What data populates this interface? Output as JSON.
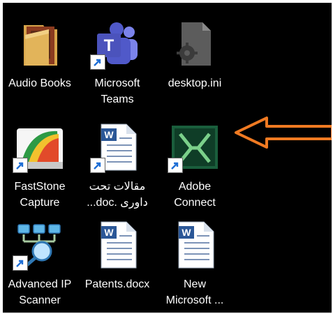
{
  "desktop": {
    "icons": [
      {
        "name": "audio-books",
        "icon": "folder-icon",
        "lines": [
          "Audio Books"
        ],
        "shortcut": false
      },
      {
        "name": "microsoft-teams",
        "icon": "teams-icon",
        "lines": [
          "Microsoft",
          "Teams"
        ],
        "shortcut": true
      },
      {
        "name": "desktop-ini",
        "icon": "settings-file-icon",
        "lines": [
          "desktop.ini"
        ],
        "shortcut": false
      },
      {
        "name": "faststone-capture",
        "icon": "faststone-icon",
        "lines": [
          "FastStone",
          "Capture"
        ],
        "shortcut": true
      },
      {
        "name": "word-doc-1",
        "icon": "word-document-icon",
        "lines": [
          "مقالات تحت",
          "داوری .doc..."
        ],
        "shortcut": true
      },
      {
        "name": "adobe-connect",
        "icon": "adobe-connect-icon",
        "lines": [
          "Adobe",
          "Connect"
        ],
        "shortcut": true
      },
      {
        "name": "advanced-ip-scanner",
        "icon": "network-scanner-icon",
        "lines": [
          "Advanced IP",
          "Scanner"
        ],
        "shortcut": true
      },
      {
        "name": "patents-docx",
        "icon": "word-document-icon",
        "lines": [
          "Patents.docx"
        ],
        "shortcut": false
      },
      {
        "name": "new-microsoft",
        "icon": "word-document-icon",
        "lines": [
          "New",
          "Microsoft ..."
        ],
        "shortcut": false
      }
    ]
  },
  "annotation": {
    "icon": "arrow-left-icon",
    "color": "#f07a22"
  }
}
